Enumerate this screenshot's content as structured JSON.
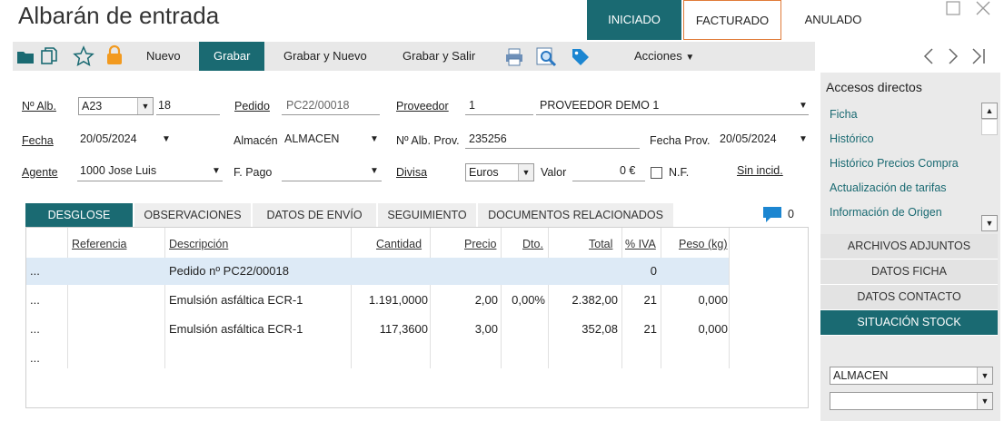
{
  "window": {
    "title": "Albarán de entrada"
  },
  "states": [
    "INICIADO",
    "FACTURADO",
    "ANULADO"
  ],
  "toolbar": {
    "nuevo": "Nuevo",
    "grabar": "Grabar",
    "grabar_nuevo": "Grabar y Nuevo",
    "grabar_salir": "Grabar y Salir",
    "acciones": "Acciones"
  },
  "form": {
    "num_alb_label": "Nº Alb.",
    "serie": "A23",
    "num": "18",
    "pedido_label": "Pedido",
    "pedido": "PC22/00018",
    "proveedor_label": "Proveedor",
    "proveedor_code": "1",
    "proveedor_name": "PROVEEDOR DEMO 1",
    "fecha_label": "Fecha",
    "fecha": "20/05/2024",
    "almacen_label": "Almacén",
    "almacen": "ALMACEN",
    "num_alb_prov_label": "Nº Alb. Prov.",
    "num_alb_prov": "235256",
    "fecha_prov_label": "Fecha Prov.",
    "fecha_prov": "20/05/2024",
    "agente_label": "Agente",
    "agente": "1000 Jose Luis",
    "f_pago_label": "F. Pago",
    "f_pago": "",
    "divisa_label": "Divisa",
    "divisa": "Euros",
    "valor_label": "Valor",
    "valor": "0 €",
    "nf_label": "N.F.",
    "sin_incid": "Sin incid."
  },
  "tabs": [
    "DESGLOSE",
    "OBSERVACIONES",
    "DATOS DE ENVÍO",
    "SEGUIMIENTO",
    "DOCUMENTOS RELACIONADOS"
  ],
  "comments_count": "0",
  "table": {
    "headers": {
      "referencia": "Referencia",
      "descripcion": "Descripción",
      "cantidad": "Cantidad",
      "precio": "Precio",
      "dto": "Dto.",
      "total": "Total",
      "iva": "% IVA",
      "peso": "Peso (kg)"
    },
    "rows": [
      {
        "marker": "...",
        "descripcion": "Pedido nº PC22/00018",
        "cantidad": "",
        "precio": "",
        "dto": "",
        "total": "",
        "iva": "0",
        "peso": ""
      },
      {
        "marker": "...",
        "descripcion": "Emulsión asfáltica ECR-1",
        "cantidad": "1.191,0000",
        "precio": "2,00",
        "dto": "0,00%",
        "total": "2.382,00",
        "iva": "21",
        "peso": "0,000"
      },
      {
        "marker": "...",
        "descripcion": "Emulsión asfáltica ECR-1",
        "cantidad": "117,3600",
        "precio": "3,00",
        "dto": "",
        "total": "352,08",
        "iva": "21",
        "peso": "0,000"
      },
      {
        "marker": "...",
        "descripcion": "",
        "cantidad": "",
        "precio": "",
        "dto": "",
        "total": "",
        "iva": "",
        "peso": ""
      }
    ]
  },
  "sidebar": {
    "title": "Accesos directos",
    "links": [
      "Ficha",
      "Histórico",
      "Histórico Precios Compra",
      "Actualización de tarifas",
      "Información de Origen"
    ],
    "buttons": [
      "ARCHIVOS ADJUNTOS",
      "DATOS FICHA",
      "DATOS CONTACTO",
      "SITUACIÓN STOCK"
    ],
    "stock_almacen": "ALMACEN",
    "stock_second": ""
  },
  "colors": {
    "accent": "#1a6a72",
    "highlight": "#e07b39",
    "selected_row": "#ddeaf6"
  },
  "icons": [
    "folder-icon",
    "copy-icon",
    "star-icon",
    "lock-icon",
    "printer-icon",
    "preview-icon",
    "tag-icon",
    "comment-icon"
  ]
}
